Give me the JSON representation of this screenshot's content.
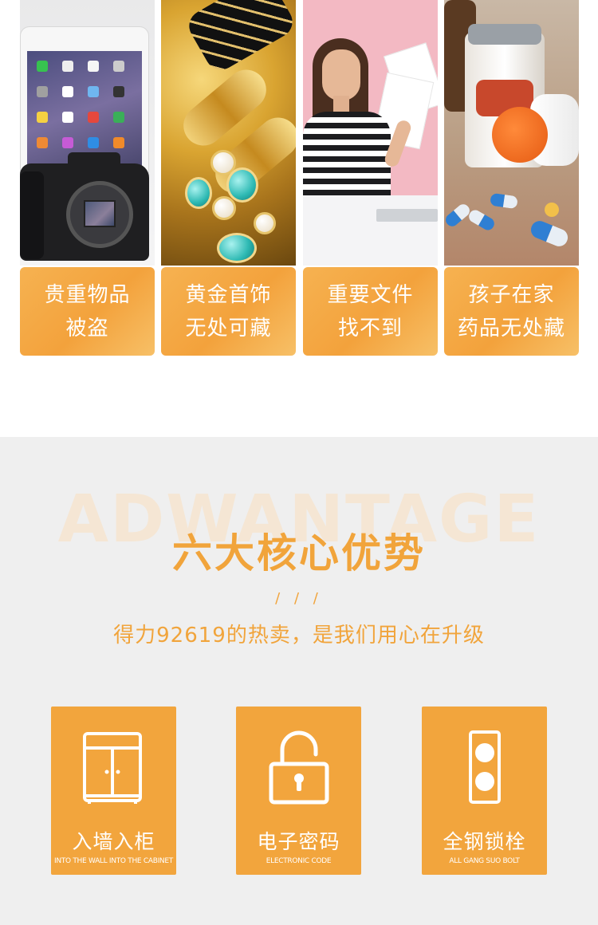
{
  "problems": [
    {
      "line1": "贵重物品",
      "line2": "被盗"
    },
    {
      "line1": "黄金首饰",
      "line2": "无处可藏"
    },
    {
      "line1": "重要文件",
      "line2": "找不到"
    },
    {
      "line1": "孩子在家",
      "line2": "药品无处藏"
    }
  ],
  "advantage": {
    "bg_word": "ADWANTAGE",
    "title": "六大核心优势",
    "slashes": "/ / /",
    "subtitle": "得力92619的热卖，是我们用心在升级"
  },
  "features": [
    {
      "name": "入墙入柜",
      "en": "INTO THE WALL INTO THE CABINET",
      "icon": "cabinet-icon"
    },
    {
      "name": "电子密码",
      "en": "ELECTRONIC CODE",
      "icon": "padlock-icon"
    },
    {
      "name": "全钢锁栓",
      "en": "ALL GANG SUO BOLT",
      "icon": "bolt-icon"
    }
  ],
  "colors": {
    "accent": "#f1a43b",
    "card_orange": "#f2a53d",
    "section_bg": "#efefef",
    "watermark": "#f5e6d4"
  }
}
